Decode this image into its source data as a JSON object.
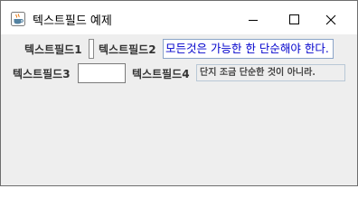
{
  "window": {
    "title": "텍스트필드 예제",
    "icon": "java-coffee-icon",
    "controls": [
      "minimize-icon",
      "maximize-icon",
      "close-icon"
    ]
  },
  "row1": {
    "label1": "텍스트필드1",
    "field1_value": "",
    "label2": "텍스트필드2",
    "field2_value": "모든것은 가능한 한 단순해야 한다."
  },
  "row2": {
    "label3": "텍스트필드3",
    "field3_value": "",
    "label4": "텍스트필드4",
    "field4_value": "단지 조금 단순한 것이 아니라."
  },
  "colors": {
    "window_bg": "#eeeeee",
    "titlebar_bg": "#ffffff",
    "field2_text": "#0000cc",
    "field4_bg": "#eeeeee"
  }
}
